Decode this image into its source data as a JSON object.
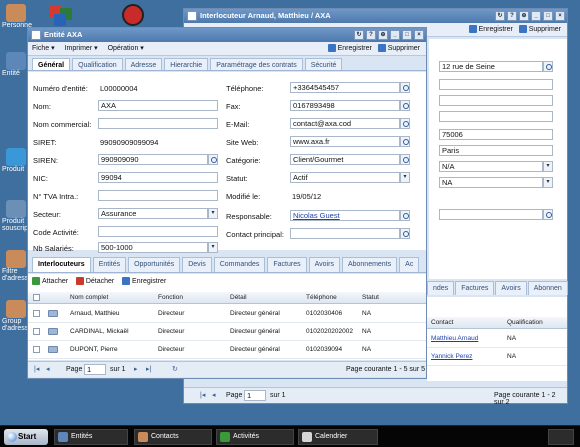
{
  "desktop": {
    "icons": [
      {
        "label": "Personne"
      },
      {
        "label": "Entité"
      },
      {
        "label": "Produit"
      },
      {
        "label": "Produit souscrip"
      },
      {
        "label": "Filtre d'adress"
      },
      {
        "label": "Group d'adresse"
      }
    ]
  },
  "taskbar": {
    "start_label": "Start",
    "tasks": [
      {
        "label": "Entités"
      },
      {
        "label": "Contacts"
      },
      {
        "label": "Activités"
      },
      {
        "label": "Calendrier"
      }
    ]
  },
  "back_window": {
    "title": "Interlocuteur Arnaud, Matthieu / AXA",
    "toolbar": {
      "save_label": "Enregistrer",
      "delete_label": "Supprimer"
    },
    "fields": {
      "street": "12 rue de Seine",
      "zip": "75006",
      "city": "Paris",
      "sel1": "N/A",
      "sel2": "NA"
    },
    "tabs": [
      "ndes",
      "Factures",
      "Avoirs",
      "Abonnen"
    ],
    "grid_headers": [
      "Contact",
      "Qualification"
    ],
    "rows": [
      {
        "contact": "Matthieu Arnaud",
        "qualification": "NA"
      },
      {
        "contact": "Yannick Perez",
        "qualification": "NA"
      }
    ],
    "pager": {
      "page_label": "Page",
      "page_value": "1",
      "of_label": "sur 1",
      "status": "Page courante 1 - 2 sur 2"
    }
  },
  "main_window": {
    "title": "Entité AXA",
    "menu": {
      "fiche": "Fiche",
      "imprimer": "Imprimer",
      "operation": "Opération",
      "save_label": "Enregistrer",
      "delete_label": "Supprimer"
    },
    "tabs": [
      "Général",
      "Qualification",
      "Adresse",
      "Hierarchie",
      "Paramétrage des contrats",
      "Sécurité"
    ],
    "left_fields": {
      "numero_label": "Numéro d'entité:",
      "numero_value": "L00000004",
      "nom_label": "Nom:",
      "nom_value": "AXA",
      "nom_commercial_label": "Nom commercial:",
      "nom_commercial_value": "",
      "siret_label": "SIRET:",
      "siret_value": "99090909099094",
      "siren_label": "SIREN:",
      "siren_value": "990909090",
      "nic_label": "NIC:",
      "nic_value": "99094",
      "tva_label": "N° TVA Intra.:",
      "tva_value": "",
      "secteur_label": "Secteur:",
      "secteur_value": "Assurance",
      "code_activite_label": "Code Activité:",
      "code_activite_value": "",
      "nb_salaries_label": "Nb Salariés:",
      "nb_salaries_value": "500-1000"
    },
    "right_fields": {
      "telephone_label": "Téléphone:",
      "telephone_value": "+3364545457",
      "fax_label": "Fax:",
      "fax_value": "0167893498",
      "email_label": "E-Mail:",
      "email_value": "contact@axa.cod",
      "site_label": "Site Web:",
      "site_value": "www.axa.fr",
      "categorie_label": "Catégorie:",
      "categorie_value": "Client/Gourmet",
      "statut_label": "Statut:",
      "statut_value": "Actif",
      "modifie_label": "Modifié le:",
      "modifie_value": "19/05/12",
      "responsable_label": "Responsable:",
      "responsable_value": "Nicolas Guest",
      "contact_principal_label": "Contact principal:",
      "contact_principal_value": ""
    },
    "sub_tabs": [
      "Interlocuteurs",
      "Entités",
      "Opportunités",
      "Devis",
      "Commandes",
      "Factures",
      "Avoirs",
      "Abonnements",
      "Ac"
    ],
    "grid_toolbar": {
      "add": "Attacher",
      "remove": "Détacher",
      "save": "Enregistrer"
    },
    "grid_headers": [
      "Nom complet",
      "Fonction",
      "Détail",
      "Téléphone",
      "Statut"
    ],
    "rows": [
      {
        "nom": "Arnaud, Matthieu",
        "fonction": "Directeur",
        "detail": "Directeur général",
        "telephone": "0102030406",
        "statut": "NA"
      },
      {
        "nom": "CARDINAL, Mickaël",
        "fonction": "Directeur",
        "detail": "Directeur général",
        "telephone": "0102020202002",
        "statut": "NA"
      },
      {
        "nom": "DUPONT, Pierre",
        "fonction": "Directeur",
        "detail": "Directeur général",
        "telephone": "0102039094",
        "statut": "NA"
      }
    ],
    "pager": {
      "page_label": "Page",
      "page_value": "1",
      "of_label": "sur 1",
      "status": "Page courante 1 - 5 sur 5"
    }
  }
}
